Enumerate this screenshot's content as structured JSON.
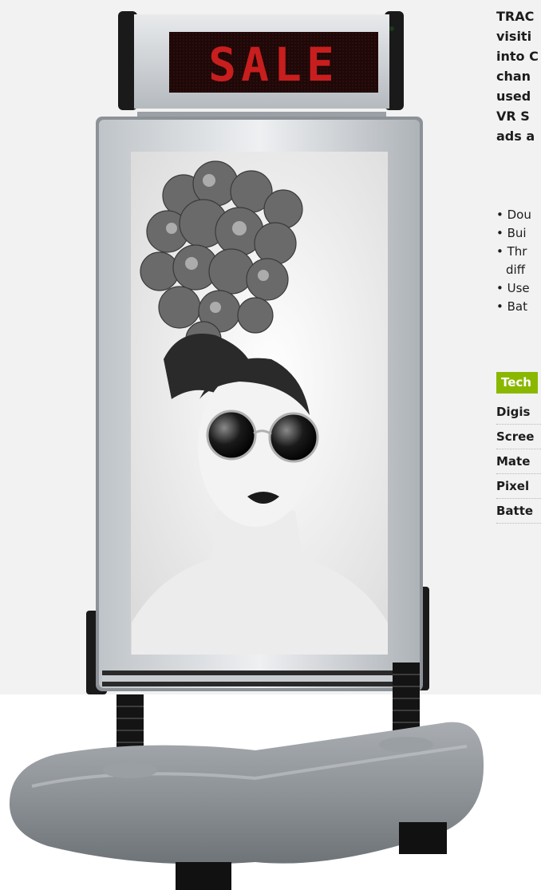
{
  "led": {
    "text": "SALE",
    "color": "#c81e1e"
  },
  "intro_lines": [
    "TRAC",
    "visiti",
    "into C",
    "chan",
    "used",
    "VR S",
    "ads a"
  ],
  "bullets": [
    {
      "text": "• Dou"
    },
    {
      "text": "• Bui"
    },
    {
      "text": "• Thr"
    },
    {
      "text": "diff",
      "continuation": true
    },
    {
      "text": "• Use"
    },
    {
      "text": "• Bat"
    }
  ],
  "technical": {
    "heading": "Tech",
    "rows": [
      "Digis",
      "Scree",
      "Mate",
      "Pixel",
      "Batte"
    ],
    "accent_color": "#8ab800"
  },
  "icons": [
    "led-sign-icon",
    "poster-frame-icon",
    "stand-base-icon"
  ]
}
